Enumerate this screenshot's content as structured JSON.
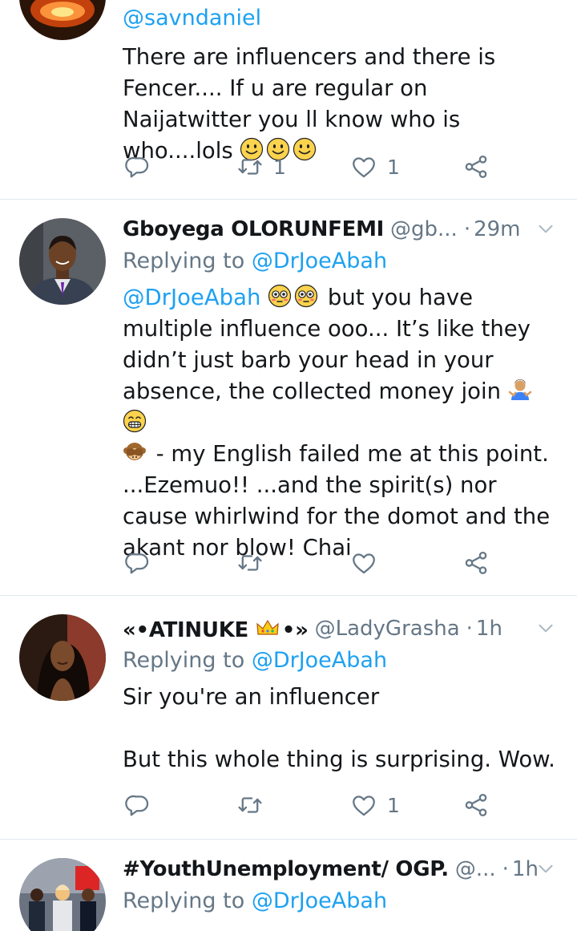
{
  "tweets": [
    {
      "reply_mention": "@savndaniel",
      "text": "There are influencers and there is Fencer.... If u are regular on Naijatwitter you ll know who is who....lols",
      "retweets": "1",
      "likes": "1"
    },
    {
      "name": "Gboyega OLORUNFEMI",
      "handle": "@gb...",
      "time": "29m",
      "replying_label": "Replying to",
      "replying_to": "@DrJoeAbah",
      "mention": "@DrJoeAbah",
      "text_a": "but you have multiple influence ooo... It’s like they didn’t just barb your head in your absence, the collected money join",
      "text_b": "- my English failed me at this point. ...Ezemuo!! ...and the spirit(s) nor cause whirlwind for the domot and the akant nor blow! Chai"
    },
    {
      "name_prefix": "«•ATINUKE",
      "name_suffix": "•»",
      "handle": "@LadyGrasha",
      "time": "1h",
      "replying_label": "Replying to",
      "replying_to": "@DrJoeAbah",
      "text": "Sir you're an influencer\n\nBut this whole thing is surprising. Wow.",
      "likes": "1"
    },
    {
      "name": "#YouthUnemployment/ OGP.",
      "handle": "@...",
      "time": "1h",
      "replying_label": "Replying to",
      "replying_to": "@DrJoeAbah"
    }
  ],
  "icons": {
    "reply": "reply-icon",
    "retweet": "retweet-icon",
    "like": "heart-icon",
    "share": "share-icon",
    "more": "chevron-down-icon"
  },
  "colors": {
    "link": "#1da1f2",
    "secondary": "#657786",
    "divider": "#e1e8ed"
  }
}
